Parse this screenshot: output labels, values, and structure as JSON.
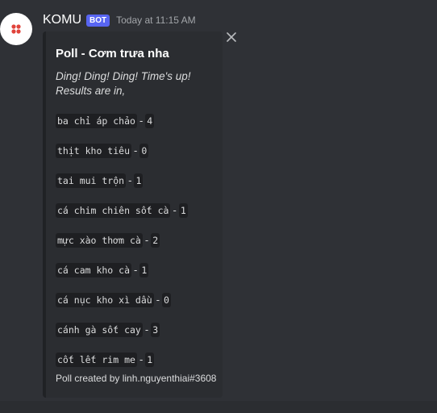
{
  "message": {
    "author": "KOMU",
    "badge": "BOT",
    "timestamp": "Today at 11:15 AM"
  },
  "embed": {
    "title": "Poll - Cơm trưa nha",
    "description": "Ding! Ding! Ding! Time's up! Results are in,",
    "options": [
      {
        "label": "ba chỉ áp chảo",
        "votes": "4"
      },
      {
        "label": "thịt kho tiêu",
        "votes": "0"
      },
      {
        "label": "tai mui trộn",
        "votes": "1"
      },
      {
        "label": "cá chim chiên sốt cà",
        "votes": "1"
      },
      {
        "label": "mực xào thơm cà",
        "votes": "2"
      },
      {
        "label": "cá cam kho cà",
        "votes": "1"
      },
      {
        "label": "cá nục kho xì dầu",
        "votes": "0"
      },
      {
        "label": "cánh gà sốt cay",
        "votes": "3"
      },
      {
        "label": "cốt lết rim me",
        "votes": "1"
      }
    ],
    "separator": "-",
    "footer": "Poll created by linh.nguyenthiai#3608"
  },
  "icons": {
    "avatar": "komu-logo-icon",
    "close": "close-icon"
  },
  "colors": {
    "background": "#2f3136",
    "embed_bg": "#2b2d31",
    "badge": "#5865f2",
    "avatar_mark": "#e0433b"
  }
}
